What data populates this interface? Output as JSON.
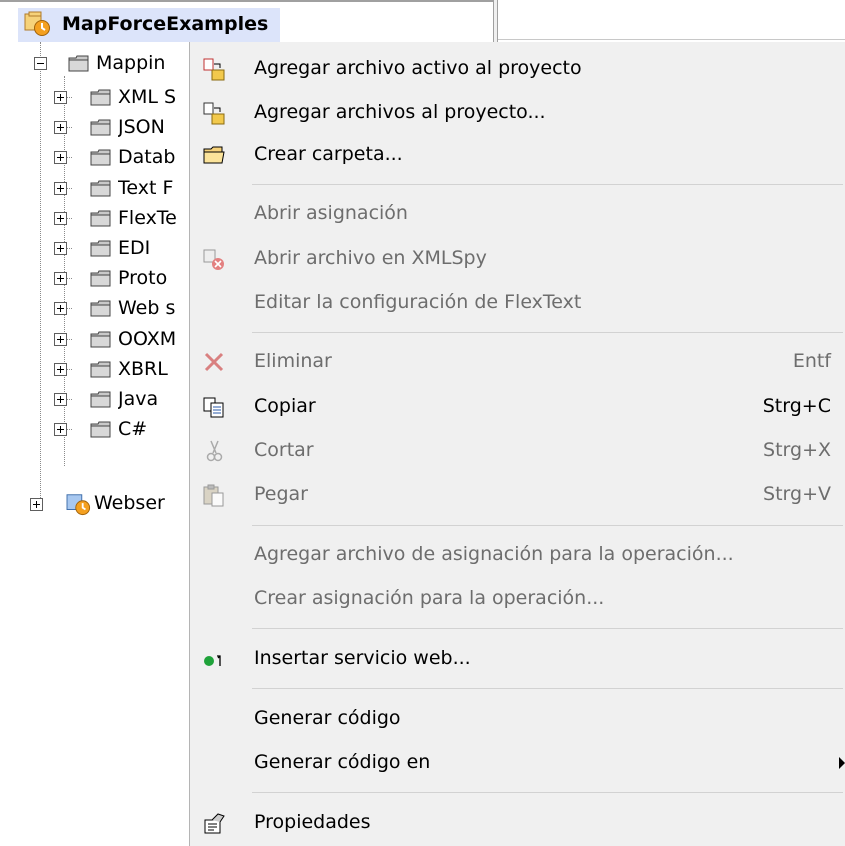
{
  "tree": {
    "root": {
      "label": "MapForceExamples",
      "icon": "project-icon"
    },
    "mappings_folder": {
      "label": "Mappin"
    },
    "children": [
      {
        "label": "XML S"
      },
      {
        "label": "JSON"
      },
      {
        "label": "Datab"
      },
      {
        "label": "Text F"
      },
      {
        "label": "FlexTe"
      },
      {
        "label": "EDI"
      },
      {
        "label": "Proto"
      },
      {
        "label": "Web s"
      },
      {
        "label": "OOXM"
      },
      {
        "label": "XBRL"
      },
      {
        "label": "Java"
      },
      {
        "label": "C#"
      }
    ],
    "webservice": {
      "label": "Webser",
      "icon": "project-icon"
    }
  },
  "context_menu": {
    "items": {
      "add_active": {
        "label": "Agregar archivo activo al proyecto",
        "icon": "add-active-file-icon",
        "enabled": true
      },
      "add_files": {
        "label": "Agregar archivos al proyecto...",
        "icon": "add-files-icon",
        "enabled": true
      },
      "create_folder": {
        "label": "Crear carpeta...",
        "icon": "folder-icon",
        "enabled": true
      },
      "open_mapping": {
        "label": "Abrir asignación",
        "enabled": false
      },
      "open_xmlspy": {
        "label": "Abrir archivo en XMLSpy",
        "icon": "xmlspy-icon",
        "enabled": false
      },
      "edit_flextext": {
        "label": "Editar la configuración de FlexText",
        "enabled": false
      },
      "delete": {
        "label": "Eliminar",
        "shortcut": "Entf",
        "icon": "delete-icon",
        "enabled": false
      },
      "copy": {
        "label": "Copiar",
        "shortcut": "Strg+C",
        "icon": "copy-icon",
        "enabled": true
      },
      "cut": {
        "label": "Cortar",
        "shortcut": "Strg+X",
        "icon": "cut-icon",
        "enabled": false
      },
      "paste": {
        "label": "Pegar",
        "shortcut": "Strg+V",
        "icon": "paste-icon",
        "enabled": false
      },
      "add_mapping_file_op": {
        "label": "Agregar archivo de asignación para la operación...",
        "enabled": false
      },
      "create_mapping_op": {
        "label": "Crear asignación para la operación...",
        "enabled": false
      },
      "insert_webservice": {
        "label": "Insertar servicio web...",
        "icon": "web-service-icon",
        "enabled": true
      },
      "generate_code": {
        "label": "Generar código",
        "enabled": true
      },
      "generate_code_in": {
        "label": "Generar código en",
        "enabled": true,
        "has_submenu": true
      },
      "properties": {
        "label": "Propiedades",
        "icon": "properties-icon",
        "enabled": true
      }
    }
  },
  "colors": {
    "menu_background": "#f0f0f0",
    "selection_highlight": "#dce4fa",
    "disabled_text": "#6d6d6d",
    "delete_icon": "#d98080",
    "web_service_dot": "#1fa23a"
  }
}
